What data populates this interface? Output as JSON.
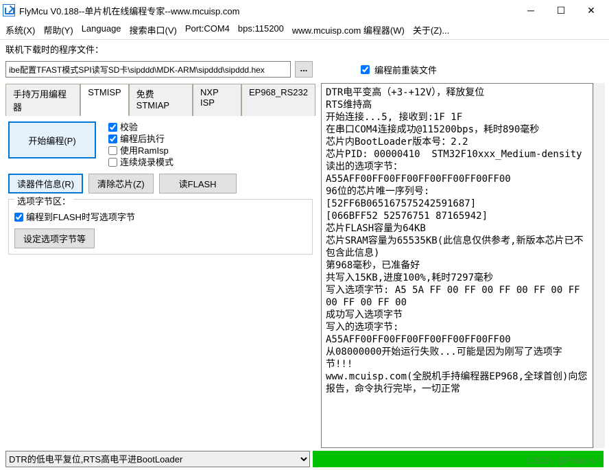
{
  "title": "FlyMcu V0.188--单片机在线编程专家--www.mcuisp.com",
  "menus": [
    "系统(X)",
    "帮助(Y)",
    "Language",
    "搜索串口(V)",
    "Port:COM4",
    "bps:115200",
    "www.mcuisp.com 编程器(W)",
    "关于(Z)..."
  ],
  "file_label": "联机下载时的程序文件：",
  "file_path": "ibe配置TFAST模式SPI读写SD卡\\sipddd\\MDK-ARM\\sipddd\\sipddd.hex",
  "browse": "...",
  "reload_chk": "编程前重装文件",
  "tabs": [
    "手持万用编程器",
    "STMISP",
    "免费STMIAP",
    "NXP ISP",
    "EP968_RS232"
  ],
  "active_tab": 1,
  "start_prog": "开始编程(P)",
  "checks": [
    {
      "label": "校验",
      "checked": true
    },
    {
      "label": "编程后执行",
      "checked": true
    },
    {
      "label": "使用RamIsp",
      "checked": false
    },
    {
      "label": "连续烧录模式",
      "checked": false
    }
  ],
  "read_info": "读器件信息(R)",
  "clear_chip": "清除芯片(Z)",
  "read_flash": "读FLASH",
  "opt_area_label": "选项字节区：",
  "opt_chk": "编程到FLASH时写选项字节",
  "set_opt_btn": "设定选项字节等",
  "dtr_option": "DTR的低电平复位,RTS高电平进BootLoader",
  "log": "DTR电平变高（+3-+12V），释放复位\nRTS维持高\n开始连接...5, 接收到:1F 1F\n在串口COM4连接成功@115200bps，耗时890毫秒\n芯片内BootLoader版本号：2.2\n芯片PID: 00000410  STM32F10xxx_Medium-density\n读出的选项字节：\nA55AFF00FF00FF00FF00FF00FF00FF00\n96位的芯片唯一序列号:\n[52FF6B065167575242591687]\n[066BFF52 52576751 87165942]\n芯片FLASH容量为64KB\n芯片SRAM容量为65535KB(此信息仅供参考,新版本芯片已不包含此信息)\n第968毫秒，已准备好\n共写入15KB,进度100%,耗时7297毫秒\n写入选项字节: A5 5A FF 00 FF 00 FF 00 FF 00 FF 00 FF 00 FF 00 \n成功写入选项字节\n写入的选项字节:\nA55AFF00FF00FF00FF00FF00FF00FF00\n从08000000开始运行失败...可能是因为刚写了选项字节!!!\nwww.mcuisp.com(全脱机手持编程器EP968,全球首创)向您报告，命令执行完毕，一切正常",
  "watermark": "CSDN @Polaris !"
}
